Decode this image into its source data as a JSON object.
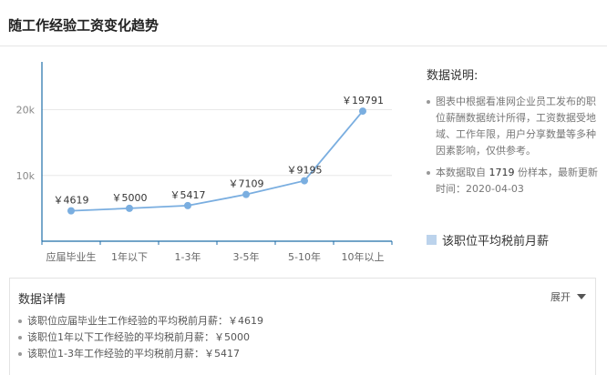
{
  "page": {
    "title": "随工作经验工资变化趋势"
  },
  "chart_data": {
    "type": "line",
    "categories": [
      "应届毕业生",
      "1年以下",
      "1-3年",
      "3-5年",
      "5-10年",
      "10年以上"
    ],
    "values": [
      4619,
      5000,
      5417,
      7109,
      9195,
      19791
    ],
    "value_labels": [
      "￥4619",
      "￥5000",
      "￥5417",
      "￥7109",
      "￥9195",
      "￥19791"
    ],
    "yticks": [
      10000,
      20000
    ],
    "ytick_labels": [
      "10k",
      "20k"
    ],
    "ylim": [
      0,
      27000
    ],
    "grid": true,
    "series": [
      {
        "name": "该职位平均税前月薪",
        "color": "#7aaee0"
      }
    ]
  },
  "notes": {
    "title": "数据说明:",
    "item1": "图表中根据看准网企业员工发布的职位薪酬数据统计所得，工资数据受地域、工作年限，用户分享数量等多种因素影响，仅供参考。",
    "item2_prefix": "本数据取自 ",
    "item2_count": "1719",
    "item2_suffix": " 份样本，最新更新时间：",
    "item2_date": "2020-04-03"
  },
  "legend": {
    "label": "该职位平均税前月薪",
    "color": "#bcd3ec"
  },
  "details": {
    "title": "数据详情",
    "expand_label": "展开",
    "items": [
      "该职位应届毕业生工作经验的平均税前月薪：￥4619",
      "该职位1年以下工作经验的平均税前月薪：￥5000",
      "该职位1-3年工作经验的平均税前月薪：￥5417"
    ]
  }
}
